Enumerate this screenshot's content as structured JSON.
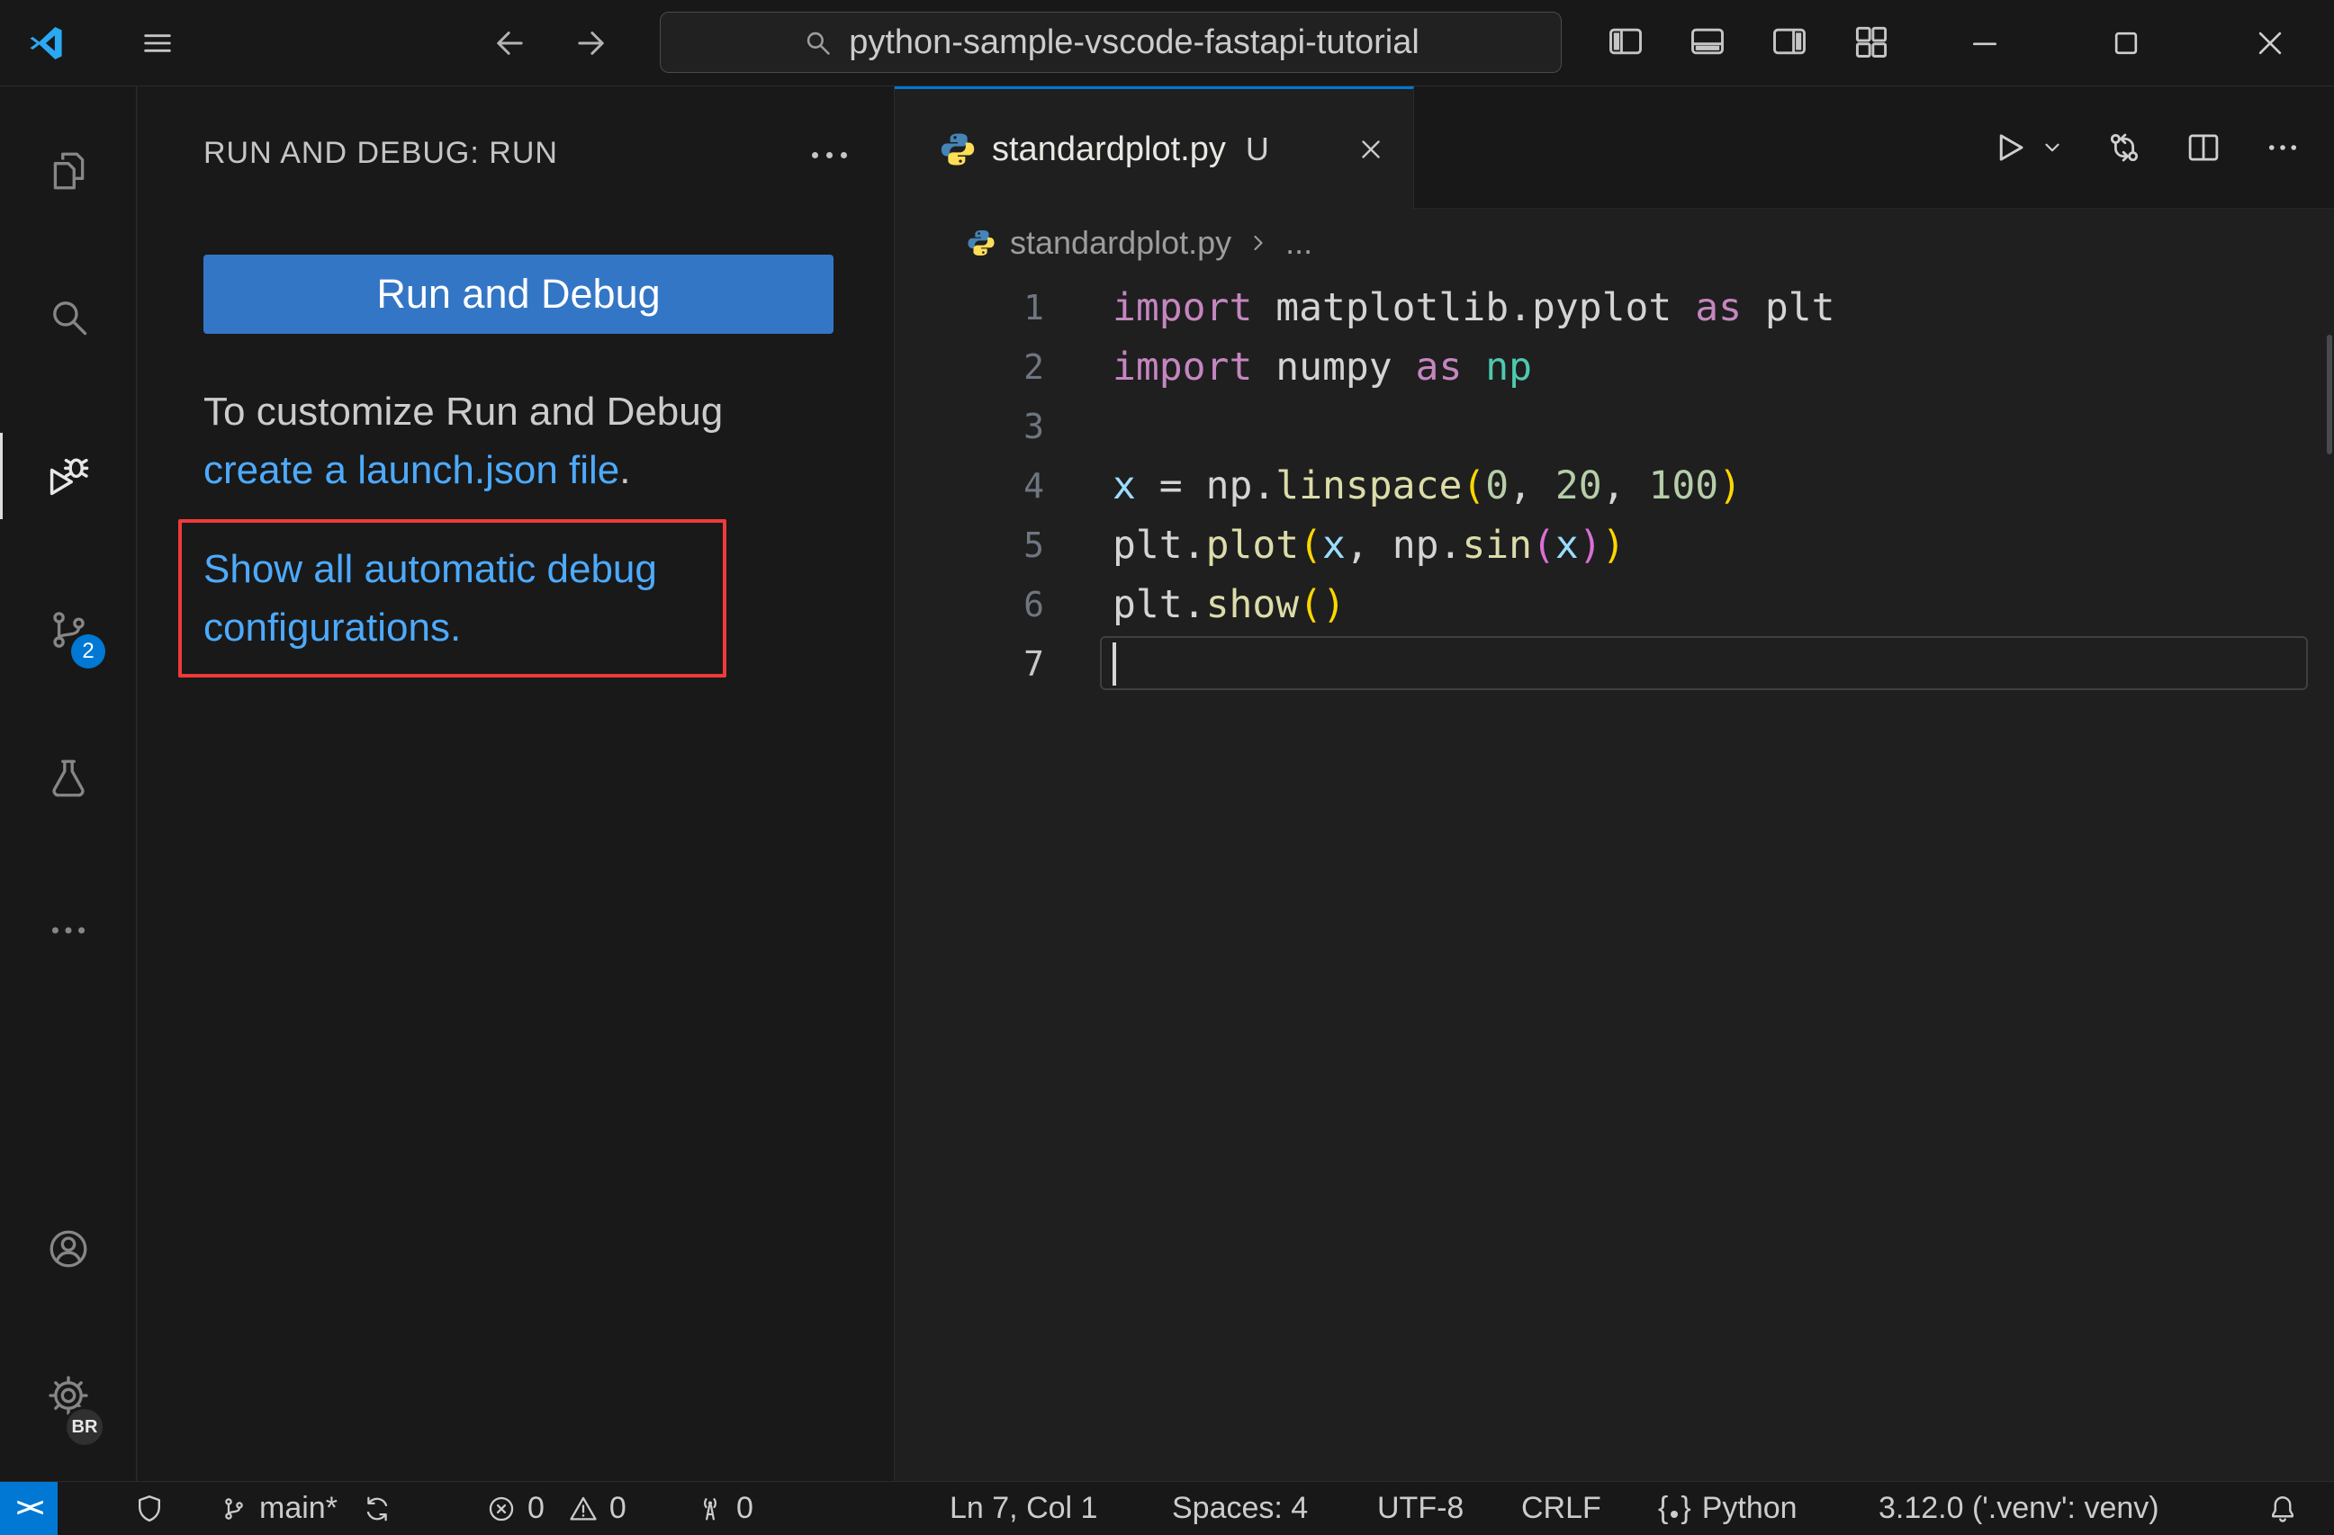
{
  "colors": {
    "accent": "#0078d4",
    "link": "#4daafc",
    "button_bg": "#3476c6",
    "button_fg": "#ffffff",
    "highlight_red": "#ef3a3a",
    "python_blue": "#4584b6",
    "python_yellow": "#ffde57"
  },
  "title_bar": {
    "search_value": "python-sample-vscode-fastapi-tutorial"
  },
  "activity_bar": {
    "source_control_badge": "2",
    "profile_badge": "BR"
  },
  "sidebar": {
    "title": "RUN AND DEBUG: RUN",
    "run_button": "Run and Debug",
    "customize_line": "To customize Run and Debug",
    "launch_link": "create a launch.json file",
    "launch_suffix": ".",
    "auto_config_link_line1": "Show all automatic debug",
    "auto_config_link_line2": "configurations."
  },
  "editor": {
    "tab_label": "standardplot.py",
    "tab_modified": "U",
    "breadcrumb_file": "standardplot.py",
    "breadcrumb_more": "...",
    "code": {
      "token_colors": {
        "keyword": "#c586c0",
        "default": "#d4d4d4",
        "module": "#4ec9b0",
        "variable": "#9cdcfe",
        "function": "#dcdcaa",
        "number": "#b5cea8",
        "paren1": "#ffd700",
        "paren2": "#da70d6"
      },
      "lines": [
        {
          "n": 1,
          "tokens": [
            {
              "t": "import ",
              "c": "keyword"
            },
            {
              "t": "matplotlib.pyplot",
              "c": "default"
            },
            {
              "t": " as ",
              "c": "keyword"
            },
            {
              "t": "plt",
              "c": "default"
            }
          ]
        },
        {
          "n": 2,
          "tokens": [
            {
              "t": "import ",
              "c": "keyword"
            },
            {
              "t": "numpy",
              "c": "default"
            },
            {
              "t": " as ",
              "c": "keyword"
            },
            {
              "t": "np",
              "c": "module"
            }
          ]
        },
        {
          "n": 3,
          "tokens": []
        },
        {
          "n": 4,
          "tokens": [
            {
              "t": "x",
              "c": "variable"
            },
            {
              "t": " = ",
              "c": "default"
            },
            {
              "t": "np",
              "c": "default"
            },
            {
              "t": ".",
              "c": "default"
            },
            {
              "t": "linspace",
              "c": "function"
            },
            {
              "t": "(",
              "c": "paren1"
            },
            {
              "t": "0",
              "c": "number"
            },
            {
              "t": ", ",
              "c": "default"
            },
            {
              "t": "20",
              "c": "number"
            },
            {
              "t": ", ",
              "c": "default"
            },
            {
              "t": "100",
              "c": "number"
            },
            {
              "t": ")",
              "c": "paren1"
            }
          ]
        },
        {
          "n": 5,
          "tokens": [
            {
              "t": "plt",
              "c": "default"
            },
            {
              "t": ".",
              "c": "default"
            },
            {
              "t": "plot",
              "c": "function"
            },
            {
              "t": "(",
              "c": "paren1"
            },
            {
              "t": "x",
              "c": "variable"
            },
            {
              "t": ", ",
              "c": "default"
            },
            {
              "t": "np",
              "c": "default"
            },
            {
              "t": ".",
              "c": "default"
            },
            {
              "t": "sin",
              "c": "function"
            },
            {
              "t": "(",
              "c": "paren2"
            },
            {
              "t": "x",
              "c": "variable"
            },
            {
              "t": ")",
              "c": "paren2"
            },
            {
              "t": ")",
              "c": "paren1"
            }
          ]
        },
        {
          "n": 6,
          "tokens": [
            {
              "t": "plt",
              "c": "default"
            },
            {
              "t": ".",
              "c": "default"
            },
            {
              "t": "show",
              "c": "function"
            },
            {
              "t": "(",
              "c": "paren1"
            },
            {
              "t": ")",
              "c": "paren1"
            }
          ]
        },
        {
          "n": 7,
          "tokens": [],
          "current": true
        }
      ]
    }
  },
  "status_bar": {
    "remote_glyph": "><",
    "branch": "main*",
    "errors": "0",
    "warnings": "0",
    "ports": "0",
    "cursor_position": "Ln 7, Col 1",
    "indent": "Spaces: 4",
    "encoding": "UTF-8",
    "eol": "CRLF",
    "brace_open": "{",
    "brace_close": "}",
    "language": "Python",
    "interpreter": "3.12.0 ('.venv': venv)"
  }
}
